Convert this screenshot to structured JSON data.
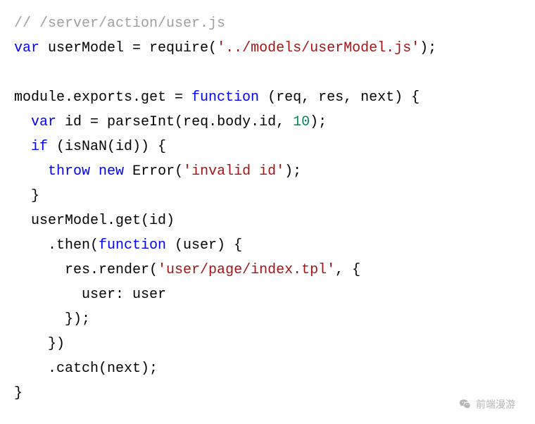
{
  "code": {
    "line1_comment": "// /server/action/user.js",
    "line2_var": "var",
    "line2_mid": " userModel = require(",
    "line2_str": "'../models/userModel.js'",
    "line2_end": ");",
    "line4_a": "module.exports.get = ",
    "line4_fn": "function",
    "line4_b": " (req, res, next) {",
    "line5_pad": "  ",
    "line5_var": "var",
    "line5_mid": " id = parseInt(req.body.id, ",
    "line5_num": "10",
    "line5_end": ");",
    "line6_pad": "  ",
    "line6_if": "if",
    "line6_rest": " (isNaN(id)) {",
    "line7_pad": "    ",
    "line7_throw": "throw",
    "line7_sp": " ",
    "line7_new": "new",
    "line7_mid": " Error(",
    "line7_str": "'invalid id'",
    "line7_end": ");",
    "line8": "  }",
    "line9": "  userModel.get(id)",
    "line10_pad": "    .then(",
    "line10_fn": "function",
    "line10_rest": " (user) {",
    "line11_pad": "      res.render(",
    "line11_str": "'user/page/index.tpl'",
    "line11_end": ", {",
    "line12": "        user: user",
    "line13": "      });",
    "line14": "    })",
    "line15": "    .catch(next);",
    "line16": "}"
  },
  "watermark": {
    "text": "前端漫游"
  }
}
